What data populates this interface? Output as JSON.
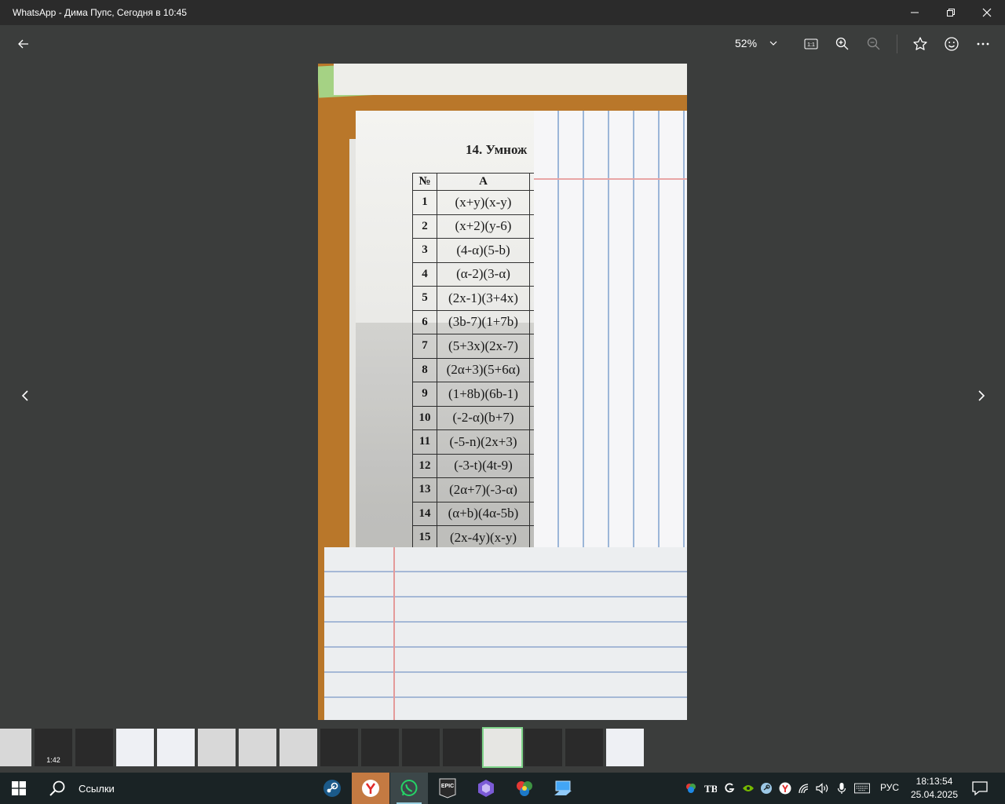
{
  "window": {
    "title": "WhatsApp - Дима Пупс, Сегодня в 10:45"
  },
  "toolbar": {
    "zoom_level": "52%"
  },
  "photo": {
    "heading": "14. Умнож",
    "table": {
      "headers": [
        "№",
        "А"
      ],
      "rows": [
        {
          "num": "1",
          "expr": "(x+y)(x-y)"
        },
        {
          "num": "2",
          "expr": "(x+2)(y-6)"
        },
        {
          "num": "3",
          "expr": "(4-α)(5-b)"
        },
        {
          "num": "4",
          "expr": "(α-2)(3-α)"
        },
        {
          "num": "5",
          "expr": "(2x-1)(3+4x)"
        },
        {
          "num": "6",
          "expr": "(3b-7)(1+7b)"
        },
        {
          "num": "7",
          "expr": "(5+3x)(2x-7)"
        },
        {
          "num": "8",
          "expr": "(2α+3)(5+6α)"
        },
        {
          "num": "9",
          "expr": "(1+8b)(6b-1)"
        },
        {
          "num": "10",
          "expr": "(-2-α)(b+7)"
        },
        {
          "num": "11",
          "expr": "(-5-n)(2x+3)"
        },
        {
          "num": "12",
          "expr": "(-3-t)(4t-9)"
        },
        {
          "num": "13",
          "expr": "(2α+7)(-3-α)"
        },
        {
          "num": "14",
          "expr": "(α+b)(4α-5b)"
        },
        {
          "num": "15",
          "expr": "(2x-4y)(x-y)"
        }
      ]
    }
  },
  "thumbnails": [
    {
      "label": "",
      "style": "light"
    },
    {
      "label": "1:42",
      "style": "dark"
    },
    {
      "label": "",
      "style": "dark"
    },
    {
      "label": "",
      "style": "doc"
    },
    {
      "label": "",
      "style": "doc"
    },
    {
      "label": "",
      "style": "light"
    },
    {
      "label": "",
      "style": "light"
    },
    {
      "label": "",
      "style": "light"
    },
    {
      "label": "",
      "style": "dark"
    },
    {
      "label": "",
      "style": "dark"
    },
    {
      "label": "",
      "style": "dark"
    },
    {
      "label": "",
      "style": "dark"
    },
    {
      "label": "",
      "style": "selected"
    },
    {
      "label": "",
      "style": "dark"
    },
    {
      "label": "",
      "style": "dark"
    },
    {
      "label": "",
      "style": "doc"
    }
  ],
  "taskbar": {
    "search_label": "Ссылки",
    "apps": [
      "steam-icon",
      "yandex-browser-icon",
      "whatsapp-icon",
      "epic-games-icon",
      "hexagon-app-icon",
      "color-wheel-icon",
      "remote-desktop-icon"
    ],
    "epic_label": "EPIC",
    "language": "РУС",
    "time": "18:13:54",
    "date": "25.04.2025"
  }
}
